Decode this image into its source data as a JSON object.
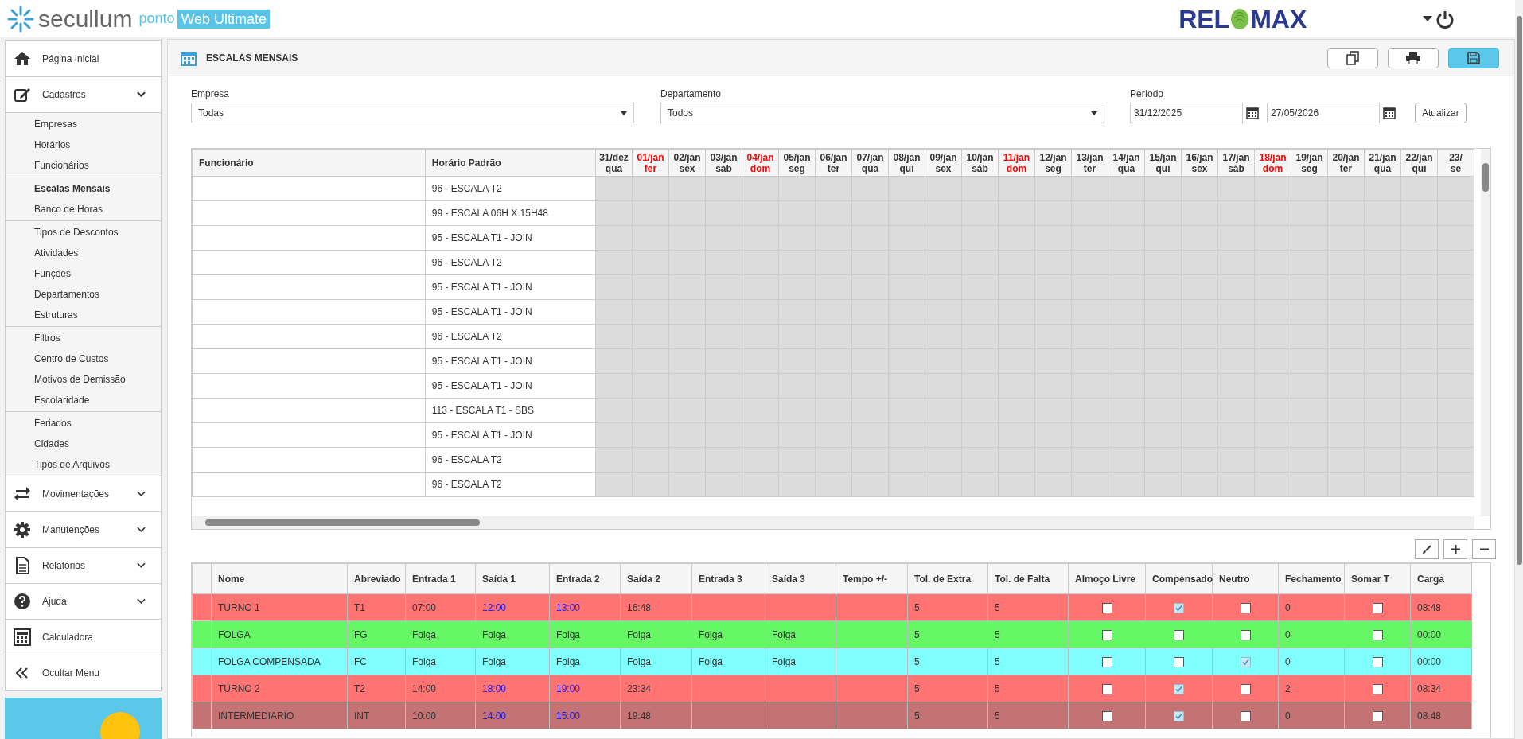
{
  "header": {
    "brand": "secullum",
    "product": "ponto",
    "edition": "Web Ultimate",
    "client_logo_left": "REL",
    "client_logo_right": "MAX"
  },
  "sidebar": {
    "items": [
      {
        "label": "Página Inicial"
      },
      {
        "label": "Cadastros",
        "expanded": true,
        "groups": [
          [
            {
              "label": "Empresas",
              "selected": false
            },
            {
              "label": "Horários",
              "selected": false
            },
            {
              "label": "Funcionários",
              "selected": false
            }
          ],
          [
            {
              "label": "Escalas Mensais",
              "selected": true
            },
            {
              "label": "Banco de Horas",
              "selected": false
            }
          ],
          [
            {
              "label": "Tipos de Descontos",
              "selected": false
            },
            {
              "label": "Atividades",
              "selected": false
            },
            {
              "label": "Funções",
              "selected": false
            },
            {
              "label": "Departamentos",
              "selected": false
            },
            {
              "label": "Estruturas",
              "selected": false
            }
          ],
          [
            {
              "label": "Filtros",
              "selected": false
            },
            {
              "label": "Centro de Custos",
              "selected": false
            },
            {
              "label": "Motivos de Demissão",
              "selected": false
            },
            {
              "label": "Escolaridade",
              "selected": false
            }
          ],
          [
            {
              "label": "Feriados",
              "selected": false
            },
            {
              "label": "Cidades",
              "selected": false
            },
            {
              "label": "Tipos de Arquivos",
              "selected": false
            }
          ]
        ]
      },
      {
        "label": "Movimentações",
        "expanded": false
      },
      {
        "label": "Manutenções",
        "expanded": false
      },
      {
        "label": "Relatórios",
        "expanded": false
      },
      {
        "label": "Ajuda",
        "expanded": false
      },
      {
        "label": "Calculadora"
      },
      {
        "label": "Ocultar Menu"
      }
    ]
  },
  "page": {
    "title": "ESCALAS MENSAIS"
  },
  "filters": {
    "empresa": {
      "label": "Empresa",
      "value": "Todas"
    },
    "departamento": {
      "label": "Departamento",
      "value": "Todos"
    },
    "periodo": {
      "label": "Período",
      "start": "31/12/2025",
      "end": "27/05/2026"
    },
    "refresh_button": "Atualizar"
  },
  "schedule_grid": {
    "columns": [
      "Funcionário",
      "Horário Padrão"
    ],
    "days": [
      {
        "date": "31/dez",
        "weekday": "qua",
        "highlighted": false
      },
      {
        "date": "01/jan",
        "weekday": "fer",
        "highlighted": true
      },
      {
        "date": "02/jan",
        "weekday": "sex",
        "highlighted": false
      },
      {
        "date": "03/jan",
        "weekday": "sáb",
        "highlighted": false
      },
      {
        "date": "04/jan",
        "weekday": "dom",
        "highlighted": true
      },
      {
        "date": "05/jan",
        "weekday": "seg",
        "highlighted": false
      },
      {
        "date": "06/jan",
        "weekday": "ter",
        "highlighted": false
      },
      {
        "date": "07/jan",
        "weekday": "qua",
        "highlighted": false
      },
      {
        "date": "08/jan",
        "weekday": "qui",
        "highlighted": false
      },
      {
        "date": "09/jan",
        "weekday": "sex",
        "highlighted": false
      },
      {
        "date": "10/jan",
        "weekday": "sáb",
        "highlighted": false
      },
      {
        "date": "11/jan",
        "weekday": "dom",
        "highlighted": true
      },
      {
        "date": "12/jan",
        "weekday": "seg",
        "highlighted": false
      },
      {
        "date": "13/jan",
        "weekday": "ter",
        "highlighted": false
      },
      {
        "date": "14/jan",
        "weekday": "qua",
        "highlighted": false
      },
      {
        "date": "15/jan",
        "weekday": "qui",
        "highlighted": false
      },
      {
        "date": "16/jan",
        "weekday": "sex",
        "highlighted": false
      },
      {
        "date": "17/jan",
        "weekday": "sáb",
        "highlighted": false
      },
      {
        "date": "18/jan",
        "weekday": "dom",
        "highlighted": true
      },
      {
        "date": "19/jan",
        "weekday": "seg",
        "highlighted": false
      },
      {
        "date": "20/jan",
        "weekday": "ter",
        "highlighted": false
      },
      {
        "date": "21/jan",
        "weekday": "qua",
        "highlighted": false
      },
      {
        "date": "22/jan",
        "weekday": "qui",
        "highlighted": false
      },
      {
        "date": "23/",
        "weekday": "se",
        "highlighted": false
      }
    ],
    "rows": [
      "96 - ESCALA T2",
      "99 - ESCALA 06H X 15H48",
      "95 - ESCALA T1 - JOIN",
      "96 - ESCALA T2",
      "95 - ESCALA T1 - JOIN",
      "95 - ESCALA T1 - JOIN",
      "96 - ESCALA T2",
      "95 - ESCALA T1 - JOIN",
      "95 - ESCALA T1 - JOIN",
      "113 - ESCALA T1 - SBS",
      "95 - ESCALA T1 - JOIN",
      "96 - ESCALA T2",
      "96 - ESCALA T2"
    ]
  },
  "shifts_table": {
    "columns": [
      "Nome",
      "Abreviado",
      "Entrada 1",
      "Saída 1",
      "Entrada 2",
      "Saída 2",
      "Entrada 3",
      "Saída 3",
      "Tempo +/-",
      "Tol. de Extra",
      "Tol. de Falta",
      "Almoço Livre",
      "Compensado",
      "Neutro",
      "Fechamento",
      "Somar T",
      "Carga"
    ],
    "rows": [
      {
        "name": "TURNO 1",
        "abbr": "T1",
        "e1": "07:00",
        "s1": "12:00",
        "e2": "13:00",
        "s2": "16:48",
        "e3": "",
        "s3": "",
        "tempo": "",
        "tol_extra": "5",
        "tol_falta": "5",
        "almoco_livre": false,
        "compensado": true,
        "neutro": false,
        "fechamento": "0",
        "somar_t": false,
        "carga": "08:48",
        "color": "#ff7373",
        "break_highlighted": true
      },
      {
        "name": "FOLGA",
        "abbr": "FG",
        "e1": "Folga",
        "s1": "Folga",
        "e2": "Folga",
        "s2": "Folga",
        "e3": "Folga",
        "s3": "Folga",
        "tempo": "",
        "tol_extra": "5",
        "tol_falta": "5",
        "almoco_livre": false,
        "compensado": false,
        "neutro": false,
        "fechamento": "0",
        "somar_t": false,
        "carga": "00:00",
        "color": "#66f766",
        "break_highlighted": false
      },
      {
        "name": "FOLGA COMPENSADA",
        "abbr": "FC",
        "e1": "Folga",
        "s1": "Folga",
        "e2": "Folga",
        "s2": "Folga",
        "e3": "Folga",
        "s3": "Folga",
        "tempo": "",
        "tol_extra": "5",
        "tol_falta": "5",
        "almoco_livre": false,
        "compensado": false,
        "neutro": true,
        "fechamento": "0",
        "somar_t": false,
        "carga": "00:00",
        "color": "#80ffff",
        "break_highlighted": false
      },
      {
        "name": "TURNO 2",
        "abbr": "T2",
        "e1": "14:00",
        "s1": "18:00",
        "e2": "19:00",
        "s2": "23:34",
        "e3": "",
        "s3": "",
        "tempo": "",
        "tol_extra": "5",
        "tol_falta": "5",
        "almoco_livre": false,
        "compensado": true,
        "neutro": false,
        "fechamento": "2",
        "somar_t": false,
        "carga": "08:34",
        "color": "#ff7373",
        "break_highlighted": true
      },
      {
        "name": "INTERMEDIARIO",
        "abbr": "INT",
        "e1": "10:00",
        "s1": "14:00",
        "e2": "15:00",
        "s2": "19:48",
        "e3": "",
        "s3": "",
        "tempo": "",
        "tol_extra": "5",
        "tol_falta": "5",
        "almoco_livre": false,
        "compensado": true,
        "neutro": false,
        "fechamento": "0",
        "somar_t": false,
        "carga": "08:48",
        "color": "#c37373",
        "break_highlighted": true
      }
    ]
  }
}
